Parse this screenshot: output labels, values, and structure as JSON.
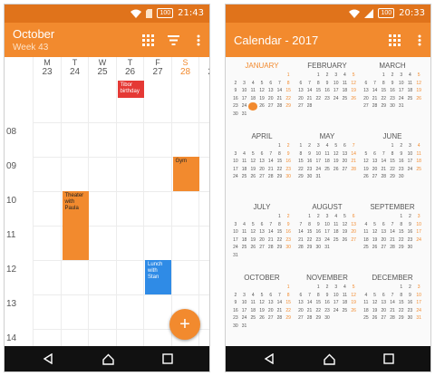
{
  "colors": {
    "accent": "#f28a2e",
    "status_bar": "#e0731b",
    "nav_bar": "#111111",
    "weekend": "#f28a2e"
  },
  "left_screen": {
    "status": {
      "battery": "100",
      "time": "21:43"
    },
    "toolbar": {
      "title": "October",
      "subtitle": "Week 43",
      "icons": [
        "calendar-grid-icon",
        "filter-icon",
        "overflow-menu-icon"
      ]
    },
    "days": [
      {
        "letter": "M",
        "date": "23",
        "today": false
      },
      {
        "letter": "T",
        "date": "24",
        "today": false
      },
      {
        "letter": "W",
        "date": "25",
        "today": false
      },
      {
        "letter": "T",
        "date": "26",
        "today": false
      },
      {
        "letter": "F",
        "date": "27",
        "today": false
      },
      {
        "letter": "S",
        "date": "28",
        "today": true
      },
      {
        "letter": "S",
        "date": "29",
        "today": false
      }
    ],
    "hours": [
      "08",
      "09",
      "10",
      "11",
      "12",
      "13",
      "14"
    ],
    "events": [
      {
        "title": "Tibor birthday",
        "color": "#e53935",
        "text_color": "#ffffff",
        "day_index": 3
      },
      {
        "title": "Gym",
        "color": "#f28a2e",
        "text_color": "#222222",
        "day_index": 5,
        "start_hour": 9.0,
        "end_hour": 10.0
      },
      {
        "title": "Theater with Paula",
        "color": "#f28a2e",
        "text_color": "#222222",
        "day_index": 1,
        "start_hour": 10.0,
        "end_hour": 12.0
      },
      {
        "title": "Lunch with Stan",
        "color": "#2f8be6",
        "text_color": "#ffffff",
        "day_index": 4,
        "start_hour": 12.0,
        "end_hour": 13.0
      }
    ],
    "fab_label": "+"
  },
  "right_screen": {
    "status": {
      "battery": "100",
      "time": "20:33"
    },
    "toolbar": {
      "title": "Calendar - 2017",
      "icons": [
        "calendar-grid-icon",
        "overflow-menu-icon"
      ]
    },
    "year": 2017,
    "current_month": "JANUARY",
    "selected_day": {
      "month": 0,
      "day": 25
    },
    "months": [
      "JANUARY",
      "FEBRUARY",
      "MARCH",
      "APRIL",
      "MAY",
      "JUNE",
      "JULY",
      "AUGUST",
      "SEPTEMBER",
      "OCTOBER",
      "NOVEMBER",
      "DECEMBER"
    ]
  }
}
